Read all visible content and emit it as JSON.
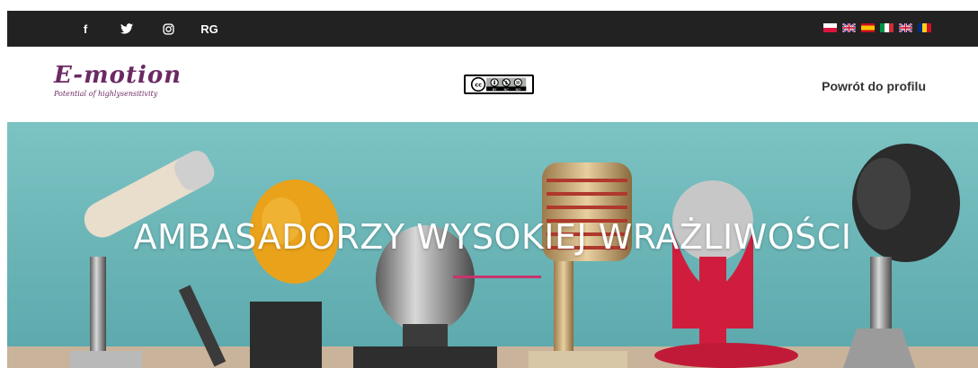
{
  "topbar": {
    "social": [
      {
        "name": "facebook-icon",
        "glyph": "f"
      },
      {
        "name": "twitter-icon",
        "glyph": ""
      },
      {
        "name": "instagram-icon",
        "glyph": ""
      },
      {
        "name": "researchgate-icon",
        "glyph": "RG"
      }
    ],
    "flags": [
      "poland-flag",
      "uk-flag",
      "spain-flag",
      "italy-flag",
      "uk-flag",
      "romania-flag"
    ],
    "colors": {
      "background": "#222222"
    }
  },
  "header": {
    "logo_title": "E-motion",
    "logo_subtitle": "Potential of highlysensitivity",
    "license_badge_icon": "cc-by-nc-nd-icon",
    "back_link": "Powrót do profilu"
  },
  "hero": {
    "title": "AMBASADORZY WYSOKIEJ WRAŻLIWOŚCI",
    "accent_color": "#c7356c",
    "background_color": "#6fb7b8"
  }
}
